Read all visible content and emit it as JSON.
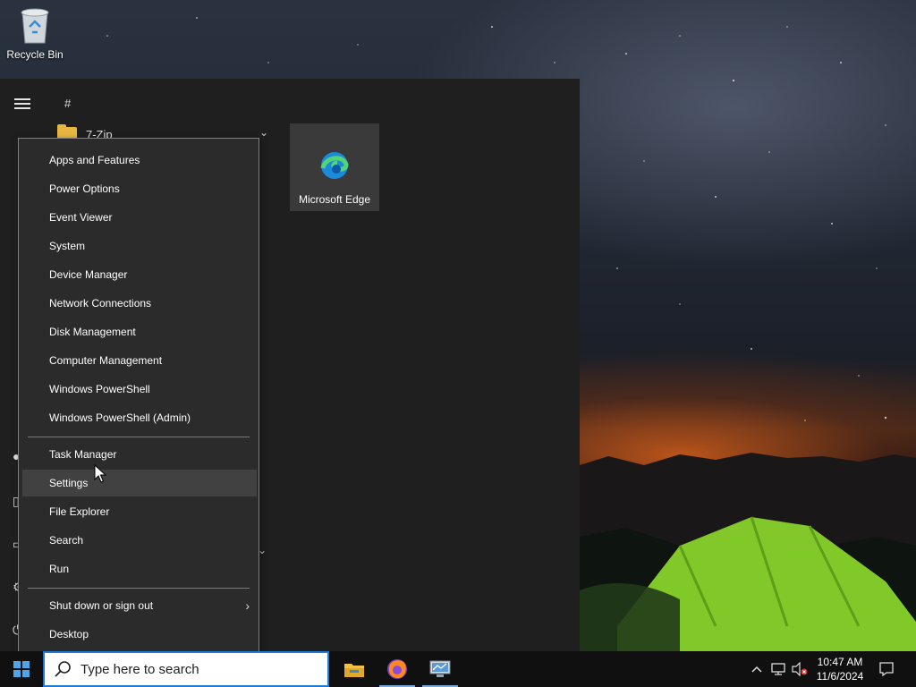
{
  "desktop": {
    "icons": [
      {
        "label": "Recycle Bin",
        "icon": "recycle-bin-icon"
      }
    ]
  },
  "start_menu": {
    "section_letter": "#",
    "apps": [
      {
        "name": "7-Zip",
        "icon": "folder-icon"
      }
    ],
    "tiles": [
      {
        "label": "Microsoft Edge",
        "icon": "edge-icon"
      }
    ]
  },
  "context_menu": {
    "group1": [
      "Apps and Features",
      "Power Options",
      "Event Viewer",
      "System",
      "Device Manager",
      "Network Connections",
      "Disk Management",
      "Computer Management",
      "Windows PowerShell",
      "Windows PowerShell (Admin)"
    ],
    "group2": [
      "Task Manager",
      "Settings",
      "File Explorer",
      "Search",
      "Run"
    ],
    "group3": [
      "Shut down or sign out",
      "Desktop"
    ],
    "highlighted": "Settings"
  },
  "taskbar": {
    "search_placeholder": "Type here to search",
    "pinned_apps": [
      "file-explorer-icon",
      "firefox-icon",
      "network-app-icon"
    ],
    "tray_icons": [
      "chevron-up-icon",
      "network-icon",
      "volume-muted-icon",
      "notification-icon"
    ],
    "time": "10:47 AM",
    "date": "11/6/2024"
  },
  "colors": {
    "accent": "#1f7ad6",
    "menu_bg": "#2b2b2b",
    "start_bg": "#1f1f1f",
    "taskbar_bg": "#101010",
    "tent": "#8edc2c"
  }
}
